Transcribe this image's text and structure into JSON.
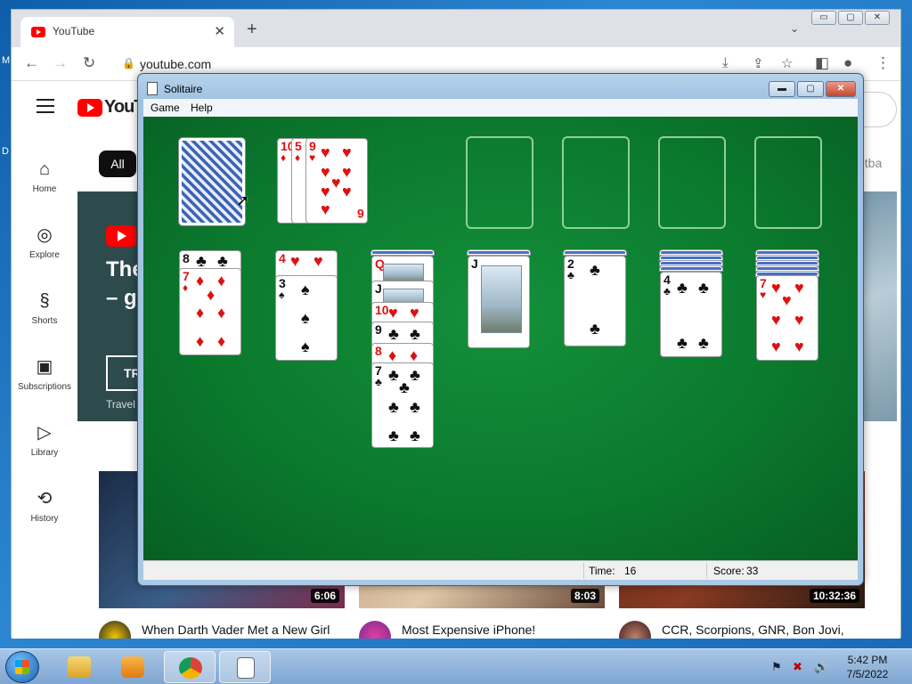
{
  "desktop": {
    "edge_letters": [
      "M",
      "D"
    ]
  },
  "browser": {
    "tab_title": "YouTube",
    "tab_close": "✕",
    "new_tab": "+",
    "url": "youtube.com",
    "window_controls": {
      "minimize": "▭",
      "maximize": "▢",
      "close": "✕"
    }
  },
  "youtube": {
    "logo_text": "YouTu",
    "sidebar": [
      {
        "label": "Home",
        "icon": "home-icon"
      },
      {
        "label": "Explore",
        "icon": "compass-icon"
      },
      {
        "label": "Shorts",
        "icon": "shorts-icon"
      },
      {
        "label": "Subscriptions",
        "icon": "subscriptions-icon"
      },
      {
        "label": "Library",
        "icon": "library-icon"
      },
      {
        "label": "History",
        "icon": "history-icon"
      }
    ],
    "chip_all": "All",
    "chip_right": "etba",
    "banner": {
      "headline_1": "The",
      "headline_2": "– g",
      "button": "TR",
      "sub": "Travel",
      "close": "✕"
    },
    "videos": [
      {
        "title": "When Darth Vader Met a New Girl from Naboo(Legends) - St",
        "duration": "6:06"
      },
      {
        "title": "Most Expensive iPhone!",
        "duration": "8:03"
      },
      {
        "title": "CCR, Scorpions, GNR, Bon Jovi, U2, Led Zeppelin, Aerosmith &...",
        "duration": "10:32:36"
      }
    ]
  },
  "solitaire": {
    "title": "Solitaire",
    "menu": [
      "Game",
      "Help"
    ],
    "controls": {
      "minimize": "▬",
      "maximize": "▢",
      "close": "✕"
    },
    "status": {
      "time_label": "Time:",
      "time_value": "16",
      "score_label": "Score:",
      "score_value": "33"
    },
    "waste": [
      "10",
      "5",
      "9",
      "6"
    ],
    "tableau_tops": [
      "8",
      "7",
      "4",
      "3",
      "Q",
      "J",
      "10",
      "9",
      "8",
      "7",
      "J",
      "2",
      "4",
      "7"
    ]
  },
  "taskbar": {
    "clock_time": "5:42 PM",
    "clock_date": "7/5/2022"
  },
  "colors": {
    "felt": "#0b7a2e",
    "yt_red": "#ff0000",
    "red_suit": "#dd1111"
  }
}
